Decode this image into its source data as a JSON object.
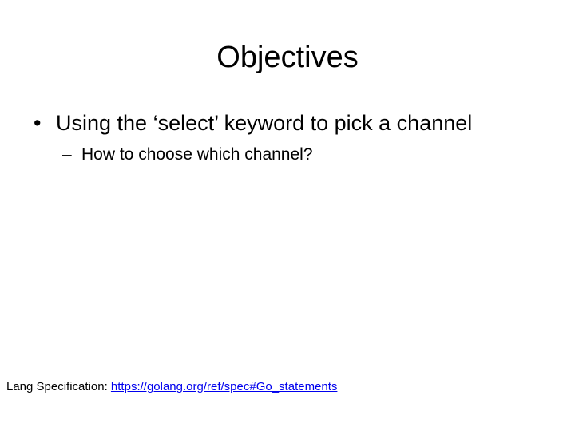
{
  "slide": {
    "title": "Objectives",
    "bullets": [
      {
        "marker": "•",
        "text": "Using the ‘select’ keyword to pick a channel",
        "sub_bullets": [
          {
            "marker": "–",
            "text": "How to choose which channel?"
          }
        ]
      }
    ],
    "footer": {
      "label": "Lang Specification: ",
      "link_text": "https://golang.org/ref/spec#Go_statements"
    }
  }
}
